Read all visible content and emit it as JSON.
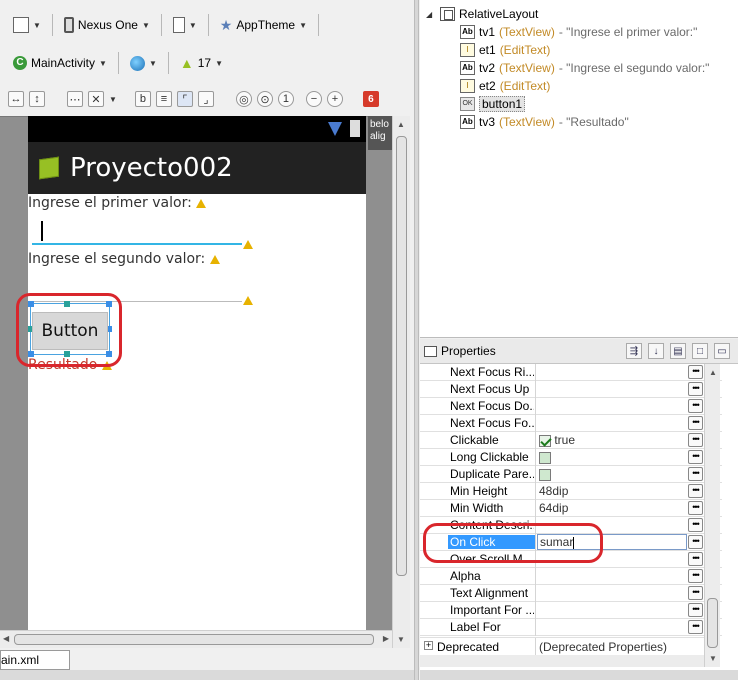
{
  "toolbar": {
    "device": "Nexus One",
    "theme": "AppTheme",
    "activity": "MainActivity",
    "api_level": "17",
    "badge_count": "6"
  },
  "preview": {
    "app_title": "Proyecto002",
    "tv1_text": "Ingrese el primer valor:",
    "tv2_text": "Ingrese el segundo valor:",
    "button_text": "Button",
    "tv3_text": "Resultado",
    "hint_text": "belo alig"
  },
  "file_tab": "ain.xml",
  "outline": {
    "root": "RelativeLayout",
    "items": [
      {
        "id": "tv1",
        "type": "(TextView)",
        "value": " - \"Ingrese el primer valor:\""
      },
      {
        "id": "et1",
        "type": "(EditText)",
        "value": ""
      },
      {
        "id": "tv2",
        "type": "(TextView)",
        "value": " - \"Ingrese el segundo valor:\""
      },
      {
        "id": "et2",
        "type": "(EditText)",
        "value": ""
      },
      {
        "id": "button1",
        "type": "",
        "value": ""
      },
      {
        "id": "tv3",
        "type": "(TextView)",
        "value": " - \"Resultado\""
      }
    ]
  },
  "properties": {
    "title": "Properties",
    "rows": [
      {
        "name": "Next Focus Ri...",
        "value": ""
      },
      {
        "name": "Next Focus Up",
        "value": ""
      },
      {
        "name": "Next Focus Do...",
        "value": ""
      },
      {
        "name": "Next Focus Fo...",
        "value": ""
      },
      {
        "name": "Clickable",
        "value": "true"
      },
      {
        "name": "Long Clickable",
        "value": ""
      },
      {
        "name": "Duplicate Pare...",
        "value": ""
      },
      {
        "name": "Min Height",
        "value": "48dip"
      },
      {
        "name": "Min Width",
        "value": "64dip"
      },
      {
        "name": "Content Descri...",
        "value": ""
      },
      {
        "name": "On Click",
        "value": "sumar"
      },
      {
        "name": "Over Scroll M...",
        "value": ""
      },
      {
        "name": "Alpha",
        "value": ""
      },
      {
        "name": "Text Alignment",
        "value": ""
      },
      {
        "name": "Important For ...",
        "value": ""
      },
      {
        "name": "Label For",
        "value": ""
      }
    ],
    "deprecated_name": "Deprecated",
    "deprecated_value": "(Deprecated Properties)",
    "ellipsis": "•••"
  },
  "colors": {
    "accent": "#33b5e5",
    "highlight_red": "#d9262c",
    "selection_blue": "#3399ff",
    "widget_type": "#c28a26"
  }
}
